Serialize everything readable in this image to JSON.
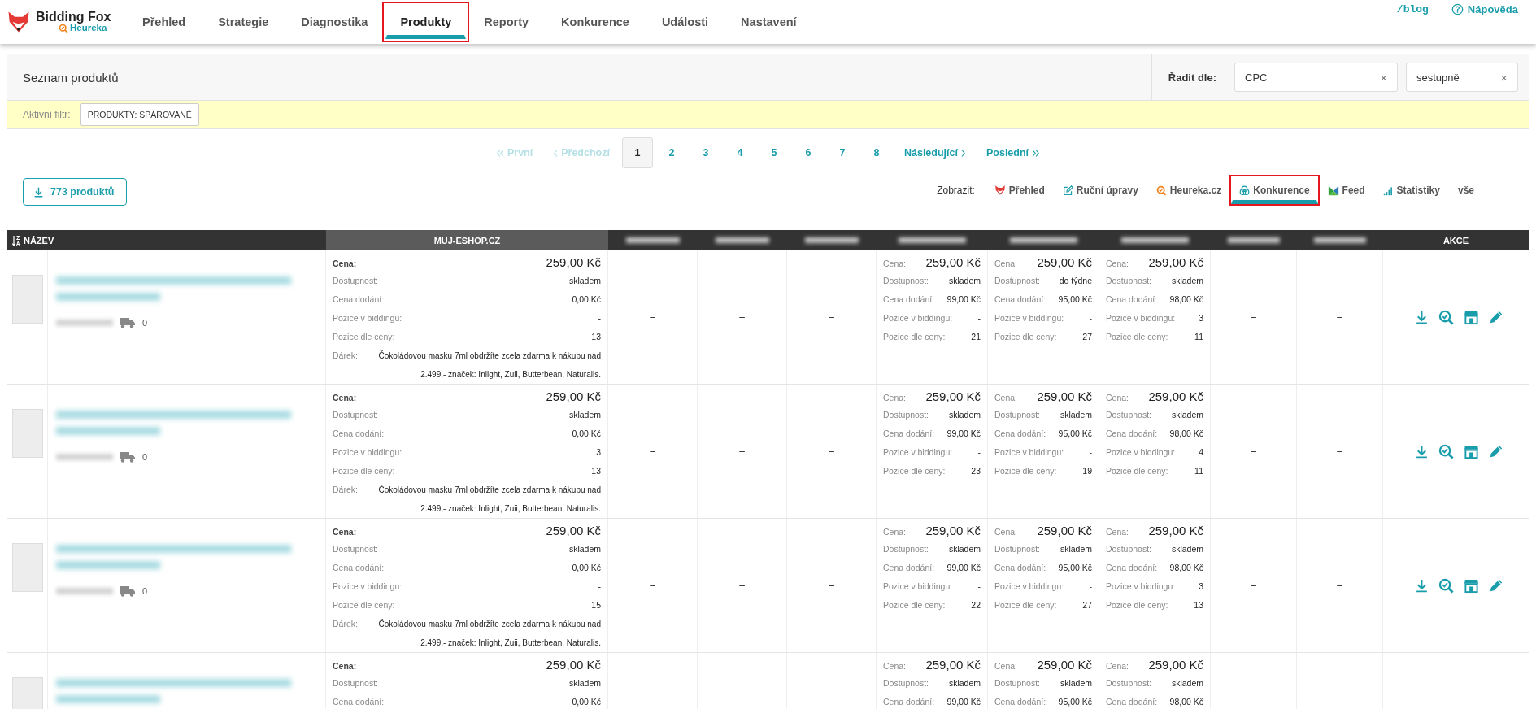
{
  "header": {
    "logo": {
      "name": "Bidding Fox",
      "sub": "Heureka"
    },
    "nav": [
      {
        "label": "Přehled",
        "selected": false,
        "highlighted": false
      },
      {
        "label": "Strategie",
        "selected": false,
        "highlighted": false
      },
      {
        "label": "Diagnostika",
        "selected": false,
        "highlighted": false
      },
      {
        "label": "Produkty",
        "selected": true,
        "highlighted": true
      },
      {
        "label": "Reporty",
        "selected": false,
        "highlighted": false
      },
      {
        "label": "Konkurence",
        "selected": false,
        "highlighted": false
      },
      {
        "label": "Události",
        "selected": false,
        "highlighted": false
      },
      {
        "label": "Nastavení",
        "selected": false,
        "highlighted": false
      }
    ],
    "links": [
      {
        "kind": "blog",
        "label": "/blog"
      },
      {
        "kind": "help",
        "label": "Nápověda"
      }
    ]
  },
  "panel": {
    "title": "Seznam produktů",
    "sort": {
      "label": "Řadit dle:",
      "fields": [
        {
          "value": "CPC",
          "clear": "×"
        },
        {
          "value": "sestupně",
          "clear": "×"
        }
      ]
    }
  },
  "filter": {
    "label": "Aktivní filtr:",
    "chips": [
      "PRODUKTY: SPÁROVANÉ"
    ]
  },
  "pagination": {
    "first": {
      "label": "První",
      "disabled": true
    },
    "prev": {
      "label": "Předchozí",
      "disabled": true
    },
    "pages": [
      {
        "label": "1",
        "selected": true
      },
      {
        "label": "2",
        "selected": false
      },
      {
        "label": "3",
        "selected": false
      },
      {
        "label": "4",
        "selected": false
      },
      {
        "label": "5",
        "selected": false
      },
      {
        "label": "6",
        "selected": false
      },
      {
        "label": "7",
        "selected": false
      },
      {
        "label": "8",
        "selected": false
      }
    ],
    "next": {
      "label": "Následující",
      "disabled": false
    },
    "last": {
      "label": "Poslední",
      "disabled": false
    }
  },
  "export_button": "773 produktů",
  "view": {
    "label": "Zobrazit:",
    "options": [
      {
        "kind": "overview",
        "label": "Přehled",
        "selected": false,
        "highlighted": false
      },
      {
        "kind": "manual",
        "label": "Ruční úpravy",
        "selected": false,
        "highlighted": false
      },
      {
        "kind": "heureka",
        "label": "Heureka.cz",
        "selected": false,
        "highlighted": false
      },
      {
        "kind": "competition",
        "label": "Konkurence",
        "selected": true,
        "highlighted": true
      },
      {
        "kind": "feed",
        "label": "Feed",
        "selected": false,
        "highlighted": false
      },
      {
        "kind": "stats",
        "label": "Statistiky",
        "selected": false,
        "highlighted": false
      },
      {
        "kind": "all",
        "label": "vše",
        "selected": false,
        "highlighted": false
      }
    ]
  },
  "table": {
    "columns": {
      "name": "NÁZEV",
      "shop": "MUJ-ESHOP.CZ",
      "actions": "AKCE"
    },
    "rows": [
      {
        "delivery": "0",
        "actions": true,
        "shop": [
          {
            "kind": "price",
            "label": "Cena:",
            "value": "259,00 Kč"
          },
          {
            "kind": "info",
            "label": "Dostupnost:",
            "value": "skladem"
          },
          {
            "kind": "info",
            "label": "Cena dodání:",
            "value": "0,00 Kč"
          },
          {
            "kind": "info",
            "label": "Pozice v biddingu:",
            "value": "-"
          },
          {
            "kind": "info",
            "label": "Pozice dle ceny:",
            "value": "13"
          },
          {
            "kind": "gift",
            "label": "Dárek:",
            "value": "Čokoládovou masku 7ml obdržíte zcela zdarma k nákupu nad 2.499,- značek: Inlight, Zuii, Butterbean, Naturalis."
          }
        ],
        "competitors": [
          {
            "kind": "empty",
            "text": "–"
          },
          {
            "kind": "empty",
            "text": "–"
          },
          {
            "kind": "empty",
            "text": "–"
          },
          {
            "kind": "offer",
            "fields": [
              {
                "kind": "price",
                "label": "Cena:",
                "value": "259,00 Kč"
              },
              {
                "kind": "info",
                "label": "Dostupnost:",
                "value": "skladem"
              },
              {
                "kind": "info",
                "label": "Cena dodání:",
                "value": "99,00 Kč"
              },
              {
                "kind": "info",
                "label": "Pozice v biddingu:",
                "value": "-"
              },
              {
                "kind": "info",
                "label": "Pozice dle ceny:",
                "value": "21"
              }
            ]
          },
          {
            "kind": "offer",
            "fields": [
              {
                "kind": "price",
                "label": "Cena:",
                "value": "259,00 Kč"
              },
              {
                "kind": "info",
                "label": "Dostupnost:",
                "value": "do týdne"
              },
              {
                "kind": "info",
                "label": "Cena dodání:",
                "value": "95,00 Kč"
              },
              {
                "kind": "info",
                "label": "Pozice v biddingu:",
                "value": "-"
              },
              {
                "kind": "info",
                "label": "Pozice dle ceny:",
                "value": "27"
              }
            ]
          },
          {
            "kind": "offer",
            "fields": [
              {
                "kind": "price",
                "label": "Cena:",
                "value": "259,00 Kč"
              },
              {
                "kind": "info",
                "label": "Dostupnost:",
                "value": "skladem"
              },
              {
                "kind": "info",
                "label": "Cena dodání:",
                "value": "98,00 Kč"
              },
              {
                "kind": "info",
                "label": "Pozice v biddingu:",
                "value": "3"
              },
              {
                "kind": "info",
                "label": "Pozice dle ceny:",
                "value": "11"
              }
            ]
          },
          {
            "kind": "empty",
            "text": "–"
          },
          {
            "kind": "empty",
            "text": "–"
          }
        ]
      },
      {
        "delivery": "0",
        "actions": true,
        "shop": [
          {
            "kind": "price",
            "label": "Cena:",
            "value": "259,00 Kč"
          },
          {
            "kind": "info",
            "label": "Dostupnost:",
            "value": "skladem"
          },
          {
            "kind": "info",
            "label": "Cena dodání:",
            "value": "0,00 Kč"
          },
          {
            "kind": "info",
            "label": "Pozice v biddingu:",
            "value": "3"
          },
          {
            "kind": "info",
            "label": "Pozice dle ceny:",
            "value": "13"
          },
          {
            "kind": "gift",
            "label": "Dárek:",
            "value": "Čokoládovou masku 7ml obdržíte zcela zdarma k nákupu nad 2.499,- značek: Inlight, Zuii, Butterbean, Naturalis."
          }
        ],
        "competitors": [
          {
            "kind": "empty",
            "text": "–"
          },
          {
            "kind": "empty",
            "text": "–"
          },
          {
            "kind": "empty",
            "text": "–"
          },
          {
            "kind": "offer",
            "fields": [
              {
                "kind": "price",
                "label": "Cena:",
                "value": "259,00 Kč"
              },
              {
                "kind": "info",
                "label": "Dostupnost:",
                "value": "skladem"
              },
              {
                "kind": "info",
                "label": "Cena dodání:",
                "value": "99,00 Kč"
              },
              {
                "kind": "info",
                "label": "Pozice v biddingu:",
                "value": "-"
              },
              {
                "kind": "info",
                "label": "Pozice dle ceny:",
                "value": "23"
              }
            ]
          },
          {
            "kind": "offer",
            "fields": [
              {
                "kind": "price",
                "label": "Cena:",
                "value": "259,00 Kč"
              },
              {
                "kind": "info",
                "label": "Dostupnost:",
                "value": "skladem"
              },
              {
                "kind": "info",
                "label": "Cena dodání:",
                "value": "95,00 Kč"
              },
              {
                "kind": "info",
                "label": "Pozice v biddingu:",
                "value": "-"
              },
              {
                "kind": "info",
                "label": "Pozice dle ceny:",
                "value": "19"
              }
            ]
          },
          {
            "kind": "offer",
            "fields": [
              {
                "kind": "price",
                "label": "Cena:",
                "value": "259,00 Kč"
              },
              {
                "kind": "info",
                "label": "Dostupnost:",
                "value": "skladem"
              },
              {
                "kind": "info",
                "label": "Cena dodání:",
                "value": "98,00 Kč"
              },
              {
                "kind": "info",
                "label": "Pozice v biddingu:",
                "value": "4"
              },
              {
                "kind": "info",
                "label": "Pozice dle ceny:",
                "value": "11"
              }
            ]
          },
          {
            "kind": "empty",
            "text": "–"
          },
          {
            "kind": "empty",
            "text": "–"
          }
        ]
      },
      {
        "delivery": "0",
        "actions": true,
        "shop": [
          {
            "kind": "price",
            "label": "Cena:",
            "value": "259,00 Kč"
          },
          {
            "kind": "info",
            "label": "Dostupnost:",
            "value": "skladem"
          },
          {
            "kind": "info",
            "label": "Cena dodání:",
            "value": "0,00 Kč"
          },
          {
            "kind": "info",
            "label": "Pozice v biddingu:",
            "value": "-"
          },
          {
            "kind": "info",
            "label": "Pozice dle ceny:",
            "value": "15"
          },
          {
            "kind": "gift",
            "label": "Dárek:",
            "value": "Čokoládovou masku 7ml obdržíte zcela zdarma k nákupu nad 2.499,- značek: Inlight, Zuii, Butterbean, Naturalis."
          }
        ],
        "competitors": [
          {
            "kind": "empty",
            "text": "–"
          },
          {
            "kind": "empty",
            "text": "–"
          },
          {
            "kind": "empty",
            "text": "–"
          },
          {
            "kind": "offer",
            "fields": [
              {
                "kind": "price",
                "label": "Cena:",
                "value": "259,00 Kč"
              },
              {
                "kind": "info",
                "label": "Dostupnost:",
                "value": "skladem"
              },
              {
                "kind": "info",
                "label": "Cena dodání:",
                "value": "99,00 Kč"
              },
              {
                "kind": "info",
                "label": "Pozice v biddingu:",
                "value": "-"
              },
              {
                "kind": "info",
                "label": "Pozice dle ceny:",
                "value": "22"
              }
            ]
          },
          {
            "kind": "offer",
            "fields": [
              {
                "kind": "price",
                "label": "Cena:",
                "value": "259,00 Kč"
              },
              {
                "kind": "info",
                "label": "Dostupnost:",
                "value": "skladem"
              },
              {
                "kind": "info",
                "label": "Cena dodání:",
                "value": "95,00 Kč"
              },
              {
                "kind": "info",
                "label": "Pozice v biddingu:",
                "value": "-"
              },
              {
                "kind": "info",
                "label": "Pozice dle ceny:",
                "value": "27"
              }
            ]
          },
          {
            "kind": "offer",
            "fields": [
              {
                "kind": "price",
                "label": "Cena:",
                "value": "259,00 Kč"
              },
              {
                "kind": "info",
                "label": "Dostupnost:",
                "value": "skladem"
              },
              {
                "kind": "info",
                "label": "Cena dodání:",
                "value": "98,00 Kč"
              },
              {
                "kind": "info",
                "label": "Pozice v biddingu:",
                "value": "3"
              },
              {
                "kind": "info",
                "label": "Pozice dle ceny:",
                "value": "13"
              }
            ]
          },
          {
            "kind": "empty",
            "text": "–"
          },
          {
            "kind": "empty",
            "text": "–"
          }
        ]
      },
      {
        "shop": [
          {
            "kind": "price",
            "label": "Cena:",
            "value": "259,00 Kč"
          },
          {
            "kind": "info",
            "label": "Dostupnost:",
            "value": "skladem"
          },
          {
            "kind": "info",
            "label": "Cena dodání:",
            "value": "0,00 Kč"
          }
        ],
        "competitors": [
          {
            "kind": "empty"
          },
          {
            "kind": "empty"
          },
          {
            "kind": "empty"
          },
          {
            "kind": "offer",
            "fields": [
              {
                "kind": "price",
                "label": "Cena:",
                "value": "259,00 Kč"
              },
              {
                "kind": "info",
                "label": "Dostupnost:",
                "value": "skladem"
              },
              {
                "kind": "info",
                "label": "Cena dodání:",
                "value": "99,00 Kč"
              }
            ]
          },
          {
            "kind": "offer",
            "fields": [
              {
                "kind": "price",
                "label": "Cena:",
                "value": "259,00 Kč"
              },
              {
                "kind": "info",
                "label": "Dostupnost:",
                "value": "skladem"
              },
              {
                "kind": "info",
                "label": "Cena dodání:",
                "value": "95,00 Kč"
              }
            ]
          },
          {
            "kind": "offer",
            "fields": [
              {
                "kind": "price",
                "label": "Cena:",
                "value": "259,00 Kč"
              },
              {
                "kind": "info",
                "label": "Dostupnost:",
                "value": "skladem"
              },
              {
                "kind": "info",
                "label": "Cena dodání:",
                "value": "98,00 Kč"
              }
            ]
          },
          {
            "kind": "empty"
          },
          {
            "kind": "empty"
          }
        ]
      }
    ]
  }
}
